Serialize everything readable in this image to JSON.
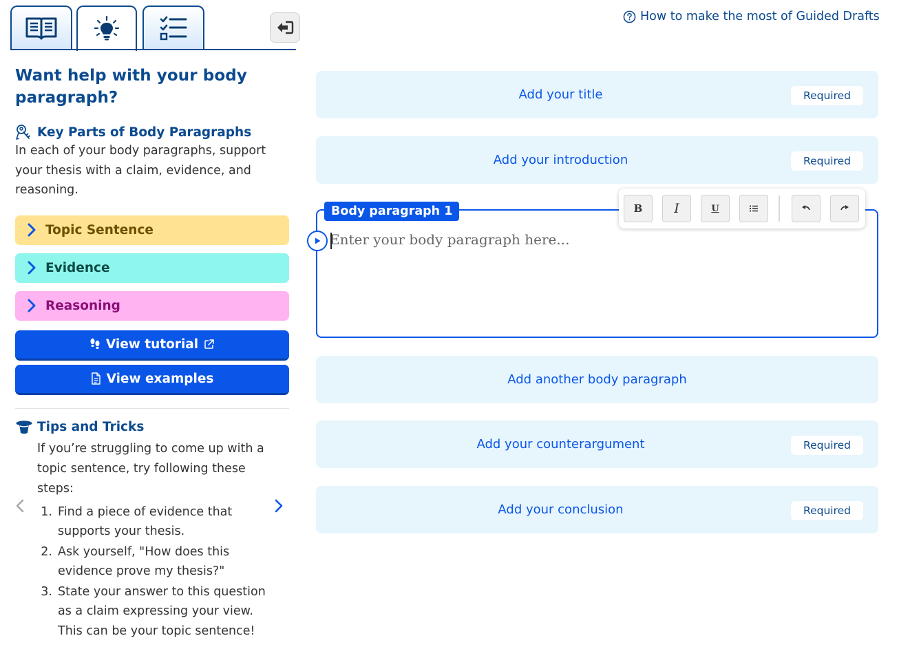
{
  "tabs": [
    {
      "name": "book",
      "icon": "book-icon",
      "active": false
    },
    {
      "name": "ideas",
      "icon": "lightbulb-icon",
      "active": true
    },
    {
      "name": "checklist",
      "icon": "checklist-icon",
      "active": false
    }
  ],
  "help_link": {
    "label": "How to make the most of Guided Drafts",
    "icon": "question-circle-icon"
  },
  "sidebar": {
    "title": "Want help with your body paragraph?",
    "key_parts": {
      "heading": "Key Parts of Body Paragraphs",
      "icon": "keys-icon",
      "description": "In each of your body paragraphs, support your thesis with a claim, evidence, and reasoning."
    },
    "accordions": [
      {
        "label": "Topic Sentence",
        "color": "#ffe392"
      },
      {
        "label": "Evidence",
        "color": "#8ef6ec"
      },
      {
        "label": "Reasoning",
        "color": "#ffb3f0"
      }
    ],
    "view_tutorial_label": "View tutorial",
    "view_examples_label": "View examples",
    "tips": {
      "heading": "Tips and Tricks",
      "icon": "magic-hat-icon",
      "intro": "If you’re struggling to come up with a topic sentence, try following these steps:",
      "steps": [
        "Find a piece of evidence that supports your thesis.",
        "Ask yourself, \"How does this evidence prove my thesis?\"",
        "State your answer to this question as a claim expressing your view. This can be your topic sentence!"
      ]
    }
  },
  "sections": {
    "title": {
      "label": "Add your title",
      "badge": "Required"
    },
    "introduction": {
      "label": "Add your introduction",
      "badge": "Required"
    },
    "another_body": {
      "label": "Add another body paragraph"
    },
    "counterargument": {
      "label": "Add your counterargument",
      "badge": "Required"
    },
    "conclusion": {
      "label": "Add your conclusion",
      "badge": "Required"
    }
  },
  "editor": {
    "label": "Body paragraph 1",
    "placeholder": "Enter your body paragraph here...",
    "toolbar": {
      "bold": "B",
      "italic": "I",
      "underline": "U"
    }
  },
  "colors": {
    "primary": "#0a56e8",
    "navy": "#0b4a8f",
    "card_bg": "#e7f5fd"
  }
}
